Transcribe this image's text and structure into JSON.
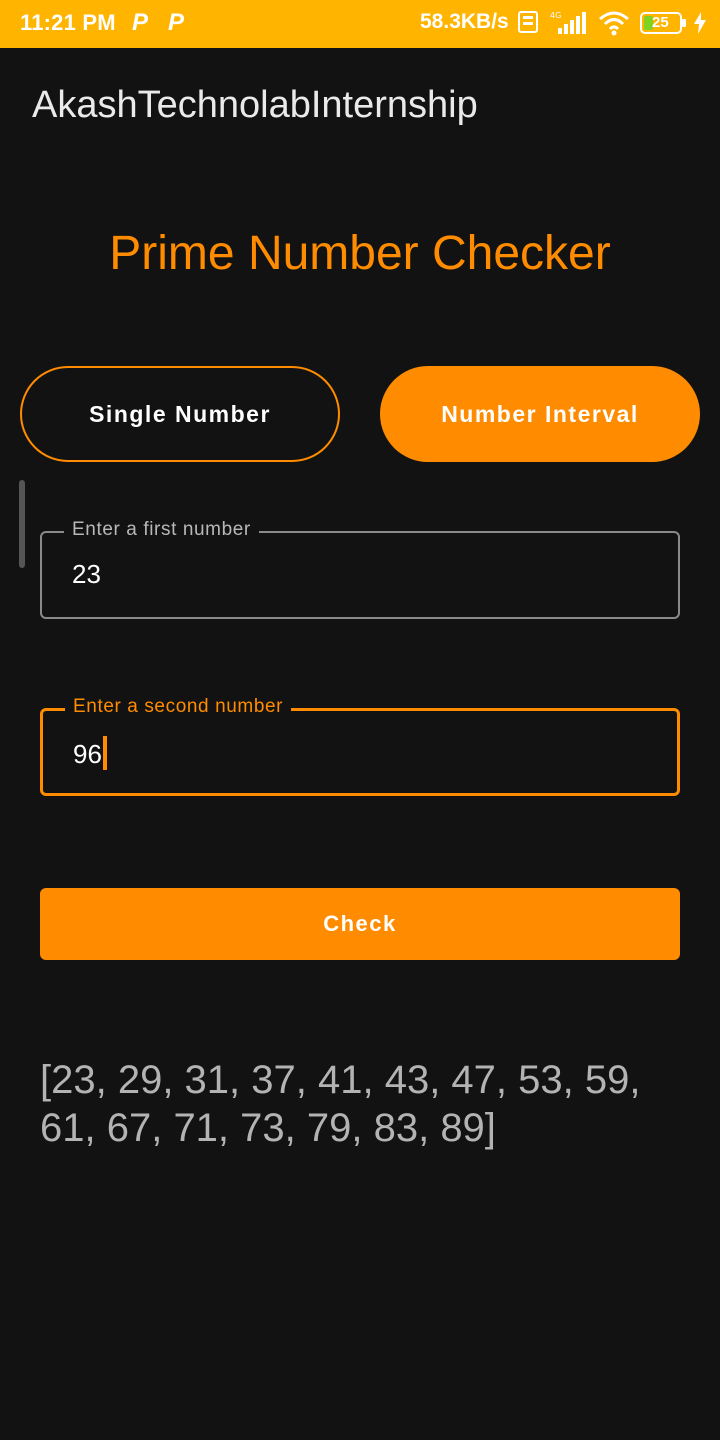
{
  "status_bar": {
    "time": "11:21 PM",
    "notification_icons": [
      "P",
      "P"
    ],
    "network_speed": "58.3KB/s",
    "battery_level": "25",
    "icons": [
      "volte-icon",
      "signal-4g-icon",
      "wifi-icon",
      "battery-icon",
      "charging-icon"
    ]
  },
  "app_bar": {
    "title": "AkashTechnolabInternship"
  },
  "page": {
    "title": "Prime Number Checker"
  },
  "mode_toggle": {
    "single_label": "Single Number",
    "interval_label": "Number Interval",
    "selected": "Number Interval"
  },
  "inputs": {
    "first": {
      "label": "Enter a first number",
      "value": "23"
    },
    "second": {
      "label": "Enter a second number",
      "value": "96"
    }
  },
  "check_button": {
    "label": "Check"
  },
  "result": {
    "text": "[23, 29, 31, 37, 41, 43, 47, 53, 59, 61, 67, 71, 73, 79, 83, 89]"
  },
  "colors": {
    "accent": "#FF8C00",
    "status_bar": "#FFB400",
    "background": "#121212"
  }
}
